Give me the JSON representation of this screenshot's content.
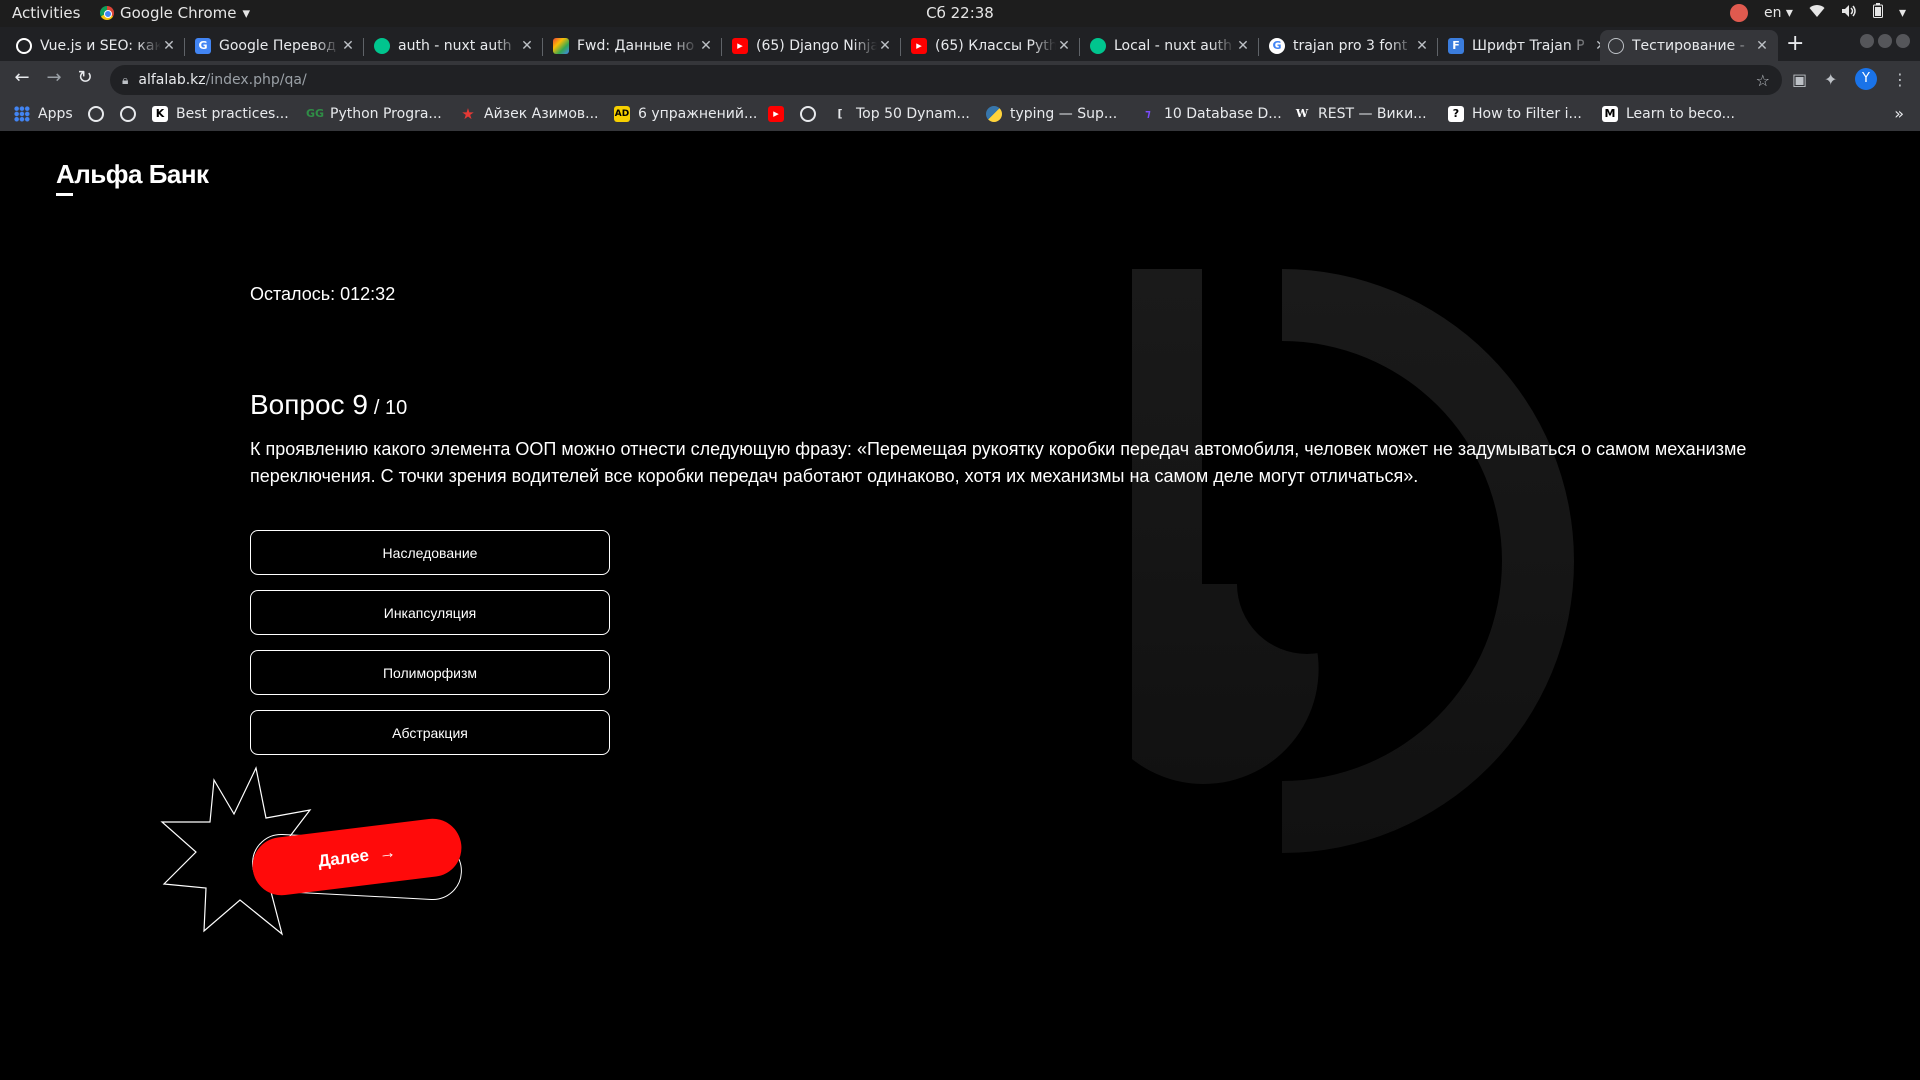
{
  "os_bar": {
    "activities": "Activities",
    "app_name": "Google Chrome",
    "clock": "Сб 22:38",
    "language": "en"
  },
  "tabs": [
    {
      "label": "Vue.js и SEO: как",
      "icon": "vue-icon",
      "color": "#ffffff"
    },
    {
      "label": "Google Перевод",
      "icon": "google-translate-icon",
      "color": "#4285f4"
    },
    {
      "label": "auth - nuxt auth",
      "icon": "nuxt-icon",
      "color": "#00c58e"
    },
    {
      "label": "Fwd: Данные но",
      "icon": "gmail-icon",
      "color": "#ea4335"
    },
    {
      "label": "(65) Django Ninja",
      "icon": "youtube-icon",
      "color": "#ff0000"
    },
    {
      "label": "(65) Классы Pyth",
      "icon": "youtube-icon",
      "color": "#ff0000"
    },
    {
      "label": "Local - nuxt auth",
      "icon": "nuxt-icon",
      "color": "#00c58e"
    },
    {
      "label": "trajan pro 3 font",
      "icon": "google-icon",
      "color": "#4285f4"
    },
    {
      "label": "Шрифт Trajan P",
      "icon": "f-icon",
      "color": "#3b7ddd"
    },
    {
      "label": "Тестирование -",
      "icon": "globe-icon",
      "color": "#9aa0a6"
    }
  ],
  "address_bar": {
    "domain": "alfalab.kz",
    "path": "/index.php/qa/"
  },
  "profile_initial": "Y",
  "bookmarks": [
    {
      "label": "Apps",
      "icon": "apps-icon",
      "color": "#4285f4"
    },
    {
      "label": "",
      "icon": "globe-icon",
      "color": "#e8eaed"
    },
    {
      "label": "",
      "icon": "globe-icon",
      "color": "#e8eaed"
    },
    {
      "label": "Best practices...",
      "icon": "ck-icon",
      "color": "#ffffff"
    },
    {
      "label": "Python Progra...",
      "icon": "gfg-icon",
      "color": "#2f8d46"
    },
    {
      "label": "Айзек Азимов...",
      "icon": "star-icon",
      "color": "#e53935"
    },
    {
      "label": "6 упражнений...",
      "icon": "ad-icon",
      "color": "#f7d000"
    },
    {
      "label": "",
      "icon": "youtube-icon",
      "color": "#ff0000"
    },
    {
      "label": "",
      "icon": "globe-icon",
      "color": "#e8eaed"
    },
    {
      "label": "Top 50 Dynam...",
      "icon": "bracket-icon",
      "color": "#e8eaed"
    },
    {
      "label": "typing — Sup...",
      "icon": "python-icon",
      "color": "#ffd43b"
    },
    {
      "label": "10 Database D...",
      "icon": "db-icon",
      "color": "#7c4dff"
    },
    {
      "label": "REST — Вики...",
      "icon": "wikipedia-icon",
      "color": "#ffffff"
    },
    {
      "label": "How to Filter i...",
      "icon": "question-icon",
      "color": "#ffffff"
    },
    {
      "label": "Learn to beco...",
      "icon": "medium-icon",
      "color": "#ffffff"
    }
  ],
  "page": {
    "logo": "Альфа Банк",
    "timer": "Осталось: 012:32",
    "question_title": "Вопрос 9",
    "question_total": "/ 10",
    "question_text": "К проявлению какого элемента ООП можно отнести следующую фразу: «Перемещая рукоятку коробки передач автомобиля, человек может не задумываться о самом механизме переключения. С точки зрения водителей все коробки передач работают одинаково, хотя их механизмы на самом деле могут отличаться».",
    "answers": [
      "Наследование",
      "Инкапсуляция",
      "Полиморфизм",
      "Абстракция"
    ],
    "next_label": "Далее",
    "next_arrow": "→",
    "accent_color": "#ff0a0a",
    "background_color": "#000000"
  }
}
